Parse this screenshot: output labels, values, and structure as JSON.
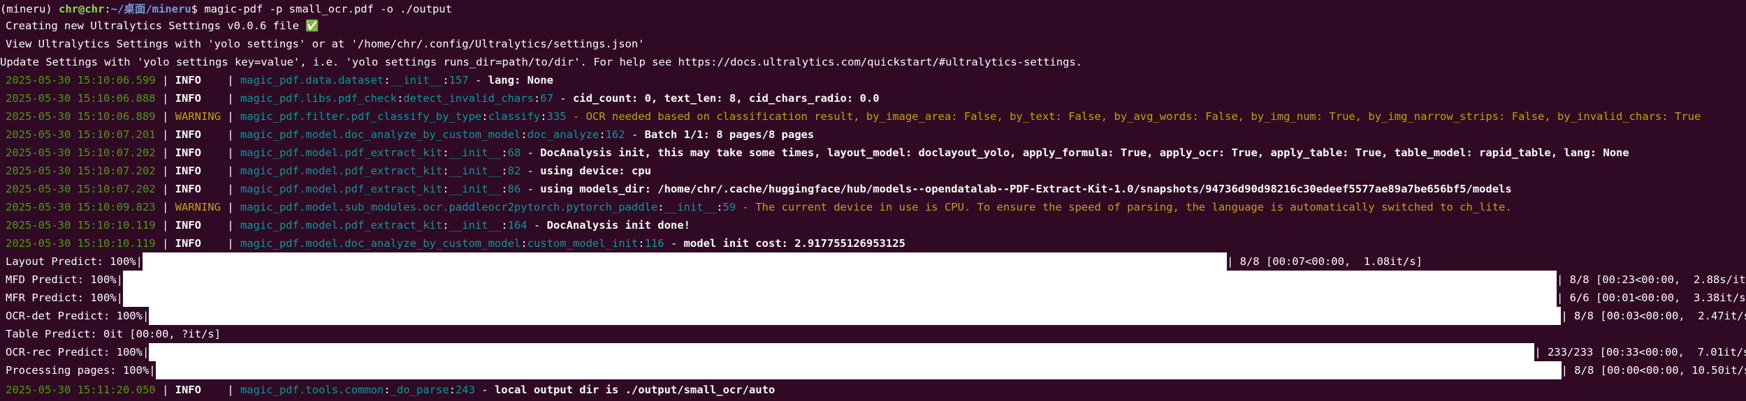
{
  "prompt": {
    "env": "(mineru) ",
    "user_host": "chr@chr",
    "colon": ":",
    "path": "~/桌面/mineru",
    "dollar": "$ ",
    "command": "magic-pdf -p small_ocr.pdf -o ./output"
  },
  "settings_lines": [
    "Creating new Ultralytics Settings v0.0.6 file ✅",
    "View Ultralytics Settings with 'yolo settings' or at '/home/chr/.config/Ultralytics/settings.json'",
    "Update Settings with 'yolo settings key=value', i.e. 'yolo settings runs_dir=path/to/dir'. For help see https://docs.ultralytics.com/quickstart/#ultralytics-settings."
  ],
  "log_lines": [
    {
      "time": "2025-05-30 15:10:06.599",
      "level": "INFO",
      "module": "magic_pdf.data.dataset",
      "func": "__init__",
      "line": "157",
      "msg": "lang: None"
    },
    {
      "time": "2025-05-30 15:10:06.888",
      "level": "INFO",
      "module": "magic_pdf.libs.pdf_check",
      "func": "detect_invalid_chars",
      "line": "67",
      "msg": "cid_count: 0, text_len: 8, cid_chars_radio: 0.0"
    },
    {
      "time": "2025-05-30 15:10:06.889",
      "level": "WARNING",
      "module": "magic_pdf.filter.pdf_classify_by_type",
      "func": "classify",
      "line": "335",
      "msg": "OCR needed based on classification result, by_image_area: False, by_text: False, by_avg_words: False, by_img_num: True, by_img_narrow_strips: False, by_invalid_chars: True"
    },
    {
      "time": "2025-05-30 15:10:07.201",
      "level": "INFO",
      "module": "magic_pdf.model.doc_analyze_by_custom_model",
      "func": "doc_analyze",
      "line": "162",
      "msg": "Batch 1/1: 8 pages/8 pages"
    },
    {
      "time": "2025-05-30 15:10:07.202",
      "level": "INFO",
      "module": "magic_pdf.model.pdf_extract_kit",
      "func": "__init__",
      "line": "68",
      "msg": "DocAnalysis init, this may take some times, layout_model: doclayout_yolo, apply_formula: True, apply_ocr: True, apply_table: True, table_model: rapid_table, lang: None"
    },
    {
      "time": "2025-05-30 15:10:07.202",
      "level": "INFO",
      "module": "magic_pdf.model.pdf_extract_kit",
      "func": "__init__",
      "line": "82",
      "msg": "using device: cpu"
    },
    {
      "time": "2025-05-30 15:10:07.202",
      "level": "INFO",
      "module": "magic_pdf.model.pdf_extract_kit",
      "func": "__init__",
      "line": "86",
      "msg": "using models_dir: /home/chr/.cache/huggingface/hub/models--opendatalab--PDF-Extract-Kit-1.0/snapshots/94736d90d98216c30edeef5577ae89a7be656bf5/models"
    },
    {
      "time": "2025-05-30 15:10:09.823",
      "level": "WARNING",
      "module": "magic_pdf.model.sub_modules.ocr.paddleocr2pytorch.pytorch_paddle",
      "func": "__init__",
      "line": "59",
      "msg": "The current device in use is CPU. To ensure the speed of parsing, the language is automatically switched to ch_lite."
    },
    {
      "time": "2025-05-30 15:10:10.119",
      "level": "INFO",
      "module": "magic_pdf.model.pdf_extract_kit",
      "func": "__init__",
      "line": "164",
      "msg": "DocAnalysis init done!"
    },
    {
      "time": "2025-05-30 15:10:10.119",
      "level": "INFO",
      "module": "magic_pdf.model.doc_analyze_by_custom_model",
      "func": "custom_model_init",
      "line": "116",
      "msg": "model init cost: 2.917755126953125"
    }
  ],
  "progress": [
    {
      "label": "Layout Predict: 100%|",
      "stats": "| 8/8 [00:07<00:00,  1.08it/s]",
      "percent": 100
    },
    {
      "label": "MFD Predict: 100%|",
      "stats": "| 8/8 [00:23<00:00,  2.88s/it]",
      "percent": 100
    },
    {
      "label": "MFR Predict: 100%|",
      "stats": "| 6/6 [00:01<00:00,  3.38it/s]",
      "percent": 100
    },
    {
      "label": "OCR-det Predict: 100%|",
      "stats": "| 8/8 [00:03<00:00,  2.47it/s]",
      "percent": 100
    },
    {
      "label": "Table Predict: 0it [00:00, ?it/s]",
      "stats": "",
      "percent": 0
    },
    {
      "label": "OCR-rec Predict: 100%|",
      "stats": "| 233/233 [00:33<00:00,  7.01it/s]",
      "percent": 100
    },
    {
      "label": "Processing pages: 100%|",
      "stats": "| 8/8 [00:00<00:00, 10.50it/s]",
      "percent": 100
    }
  ],
  "final_log": {
    "time": "2025-05-30 15:11:20.050",
    "level": "INFO",
    "module": "magic_pdf.tools.common",
    "func": "_do_parse",
    "line": "243",
    "msg": "local output dir is ./output/small_ocr/auto"
  },
  "colors": {
    "background": "#300a24",
    "timestamp": "#4e9a06",
    "module": "#06989a",
    "warning": "#c4a000",
    "prompt_user": "#8ae234",
    "prompt_path": "#729fcf"
  }
}
